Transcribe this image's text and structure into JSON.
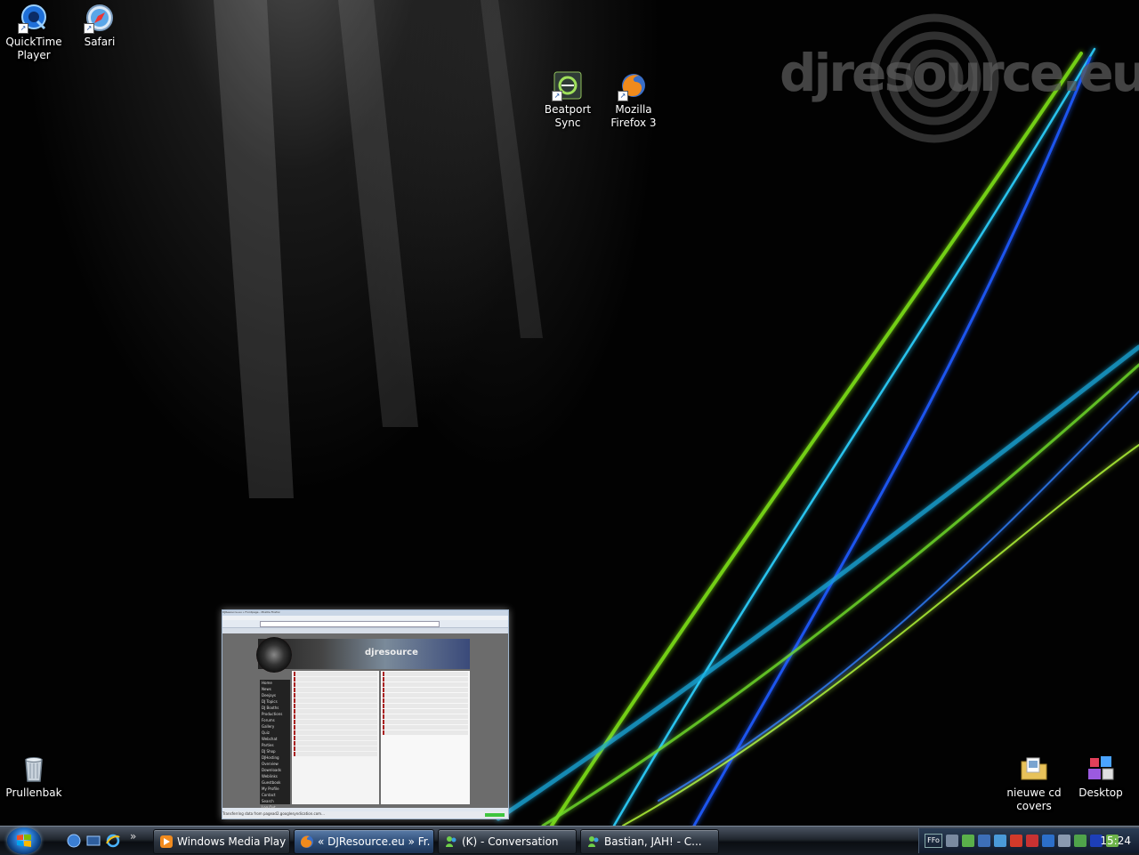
{
  "desktop": {
    "brand_text": "djresource.eu",
    "icons": [
      {
        "label": "QuickTime Player",
        "icon": "quicktime-icon"
      },
      {
        "label": "Safari",
        "icon": "safari-icon"
      },
      {
        "label": "Beatport Sync",
        "icon": "beatport-sync-icon"
      },
      {
        "label": "Mozilla Firefox 3",
        "icon": "firefox-icon"
      },
      {
        "label": "Prullenbak",
        "icon": "recycle-bin-icon"
      },
      {
        "label": "nieuwe cd covers",
        "icon": "folder-icon"
      },
      {
        "label": "Desktop",
        "icon": "desktop-folder-icon"
      }
    ]
  },
  "preview": {
    "title": "DJResource.eu » Frontpage - Mozilla Firefox",
    "banner_text": "djresource",
    "nav": [
      "Home",
      "News",
      "Deejays",
      "DJ Topics",
      "DJ Booths",
      "Productions",
      "Forums",
      "Gallery",
      "Quiz",
      "Webchat",
      "Parties",
      "DJ Shop",
      "DJHosting",
      "Overview",
      "Downloads",
      "Weblinks",
      "Guestbook",
      "My Profile",
      "Contact",
      "Search",
      "Log Out"
    ],
    "status": "Transferring data from pagead2.googlesyndication.com..."
  },
  "taskbar": {
    "tasks": [
      {
        "label": "Windows Media Player",
        "icon": "windows-media-player-icon",
        "active": false
      },
      {
        "label": "« DJResource.eu » Fr...",
        "icon": "firefox-icon",
        "active": true
      },
      {
        "label": "(K) - Conversation",
        "icon": "messenger-icon",
        "active": false
      },
      {
        "label": "Bastian,        JAH! - C...",
        "icon": "messenger-icon",
        "active": false
      }
    ],
    "quicklaunch_more": "»",
    "tray_language": "FFo",
    "clock": "15:24"
  },
  "colors": {
    "wave_green": "#7ee21a",
    "wave_cyan": "#27c7ff",
    "wave_blue": "#1f5bff",
    "wave_lime": "#b8ff3a"
  }
}
